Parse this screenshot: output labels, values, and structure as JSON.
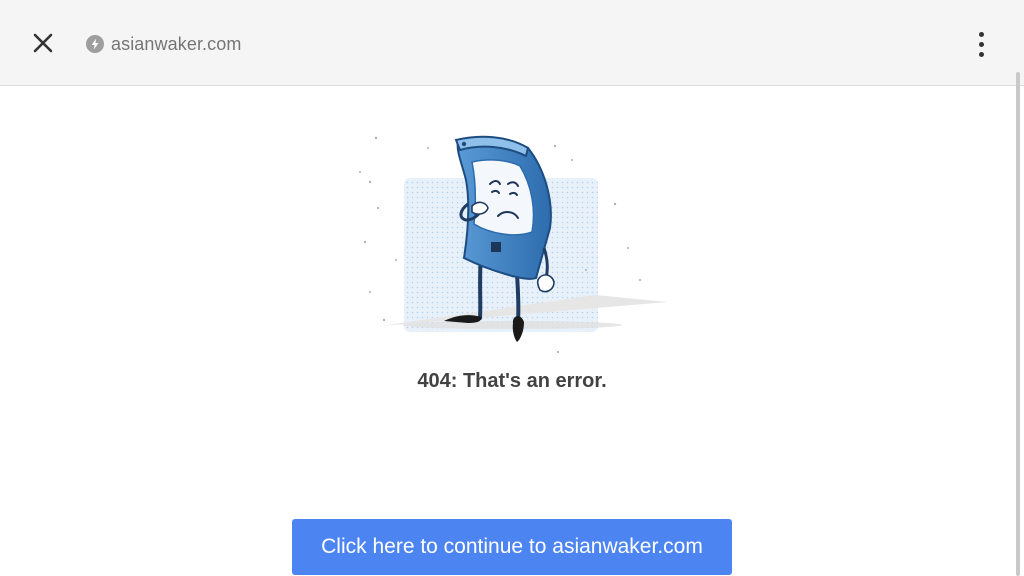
{
  "topbar": {
    "close_icon": "close-icon",
    "amp_icon": "amp-lightning-icon",
    "url": "asianwaker.com",
    "menu_icon": "more-vert-icon"
  },
  "main": {
    "illustration": "sad-phone-illustration",
    "error_message": "404: That's an error.",
    "continue_button_label": "Click here to continue to asianwaker.com"
  },
  "colors": {
    "accent": "#4c84f1",
    "topbar_bg": "#f5f5f5",
    "text": "#424242",
    "url_text": "#757575"
  }
}
